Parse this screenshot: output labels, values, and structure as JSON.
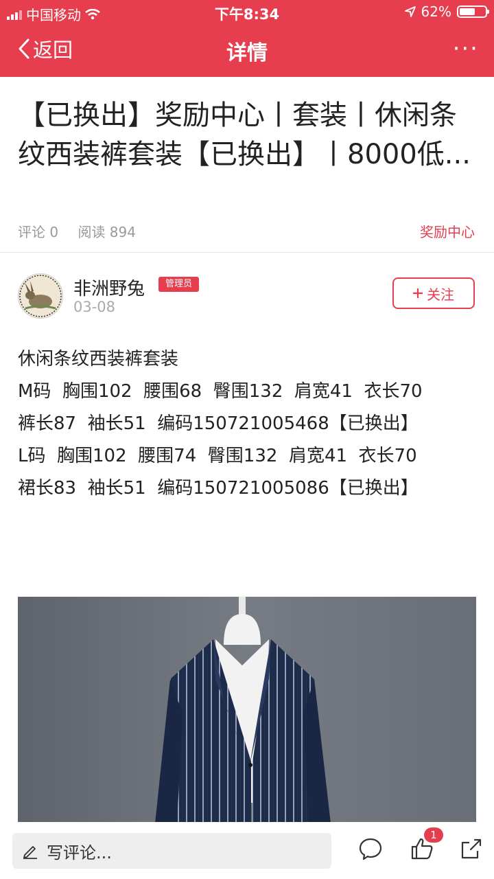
{
  "status_bar": {
    "carrier": "中国移动",
    "time": "下午8:34",
    "battery_percent": "62%",
    "battery_level": 0.62,
    "signal_icon": "signal-bars-icon",
    "wifi_icon": "wifi-icon",
    "location_icon": "location-arrow-icon"
  },
  "nav": {
    "back_label": "返回",
    "title": "详情",
    "more_label": "···"
  },
  "article": {
    "title": "【已换出】奖励中心丨套装丨休闲条纹西装裤套装【已换出】丨8000低...",
    "comments": "评论 0",
    "reads": "阅读 894",
    "category": "奖励中心"
  },
  "author": {
    "name": "非洲野兔",
    "badge": "管理员",
    "date": "03-08",
    "follow_label": "关注"
  },
  "content": {
    "lines": [
      "休闲条纹西装裤套装",
      "M码  胸围102  腰围68  臀围132  肩宽41  衣长70",
      "裤长87  袖长51  编码150721005468【已换出】",
      "",
      "",
      "L码  胸围102  腰围74  臀围132  肩宽41  衣长70",
      "裙长83  袖长51  编码150721005086【已换出】"
    ]
  },
  "bottom_bar": {
    "comment_placeholder": "写评论...",
    "like_count": "1"
  },
  "colors": {
    "accent": "#e63e4f",
    "photo_background": "#6c7079",
    "jacket": "#1e2c4c"
  }
}
